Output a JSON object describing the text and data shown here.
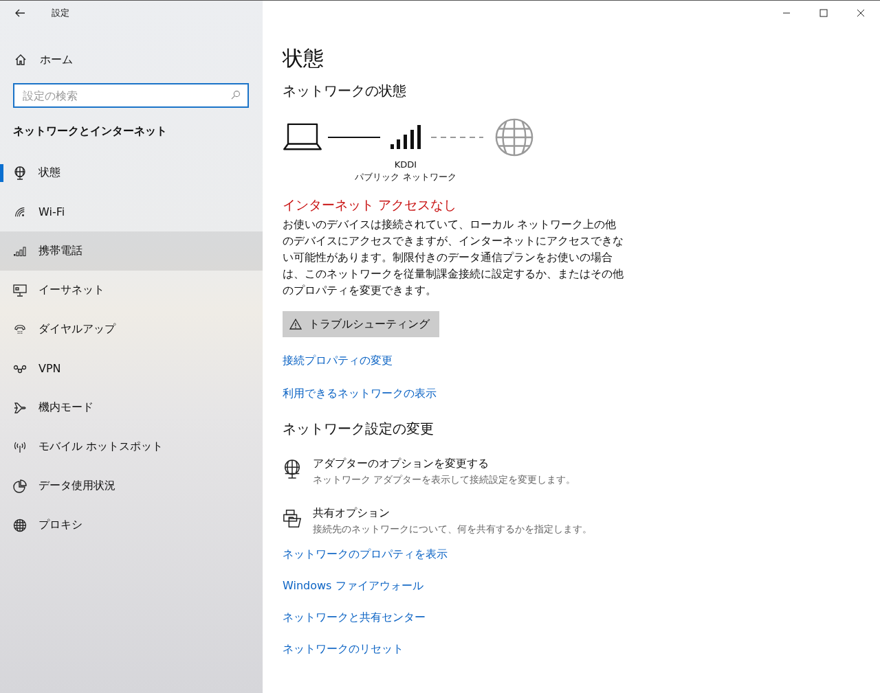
{
  "window": {
    "title": "設定"
  },
  "sidebar": {
    "home": "ホーム",
    "search": {
      "placeholder": "設定の検索"
    },
    "section_title": "ネットワークとインターネット",
    "items": [
      {
        "label": "状態",
        "selected": true,
        "hovered": false
      },
      {
        "label": "Wi-Fi",
        "selected": false,
        "hovered": false
      },
      {
        "label": "携帯電話",
        "selected": false,
        "hovered": true
      },
      {
        "label": "イーサネット",
        "selected": false,
        "hovered": false
      },
      {
        "label": "ダイヤルアップ",
        "selected": false,
        "hovered": false
      },
      {
        "label": "VPN",
        "selected": false,
        "hovered": false
      },
      {
        "label": "機内モード",
        "selected": false,
        "hovered": false
      },
      {
        "label": "モバイル ホットスポット",
        "selected": false,
        "hovered": false
      },
      {
        "label": "データ使用状況",
        "selected": false,
        "hovered": false
      },
      {
        "label": "プロキシ",
        "selected": false,
        "hovered": false
      }
    ]
  },
  "main": {
    "title": "状態",
    "network_heading": "ネットワークの状態",
    "diagram": {
      "network_name": "KDDI",
      "network_type": "パブリック ネットワーク",
      "internet_connected": false
    },
    "alert": "インターネット アクセスなし",
    "description": "お使いのデバイスは接続されていて、ローカル ネットワーク上の他のデバイスにアクセスできますが、インターネットにアクセスできない可能性があります。制限付きのデータ通信プランをお使いの場合は、このネットワークを従量制課金接続に設定するか、またはその他のプロパティを変更できます。",
    "troubleshoot_button": "トラブルシューティング",
    "links": [
      "接続プロパティの変更",
      "利用できるネットワークの表示"
    ],
    "settings_heading": "ネットワーク設定の変更",
    "options": [
      {
        "title": "アダプターのオプションを変更する",
        "description": "ネットワーク アダプターを表示して接続設定を変更します。"
      },
      {
        "title": "共有オプション",
        "description": "接続先のネットワークについて、何を共有するかを指定します。"
      }
    ],
    "bottom_links": [
      "ネットワークのプロパティを表示",
      "Windows ファイアウォール",
      "ネットワークと共有センター",
      "ネットワークのリセット"
    ]
  }
}
